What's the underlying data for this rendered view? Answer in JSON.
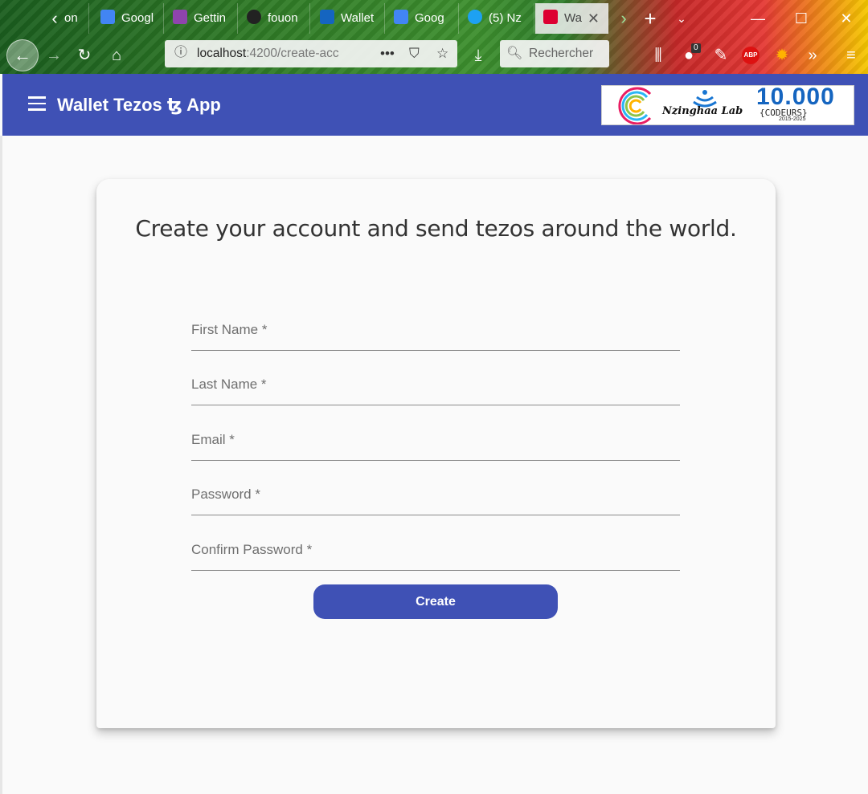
{
  "browser": {
    "tabs": [
      {
        "label": "on",
        "favicon_color": "#4b7c3a"
      },
      {
        "label": "Googl",
        "favicon_color": "#4285f4"
      },
      {
        "label": "Gettin",
        "favicon_color": "#8e44ad"
      },
      {
        "label": "fouon",
        "favicon_color": "#222222"
      },
      {
        "label": "Wallet",
        "favicon_color": "#1565c0"
      },
      {
        "label": "Goog",
        "favicon_color": "#4285f4"
      },
      {
        "label": "(5) Nz",
        "favicon_color": "#1da1f2"
      },
      {
        "label": "Wa",
        "favicon_color": "#dd0031",
        "active": true
      }
    ],
    "url_host": "localhost",
    "url_path": ":4200/create-acc",
    "search_placeholder": "Rechercher",
    "notification_count": "0",
    "adblock_label": "ABP"
  },
  "app": {
    "title": "Wallet Tezos ꜩ App",
    "partner_logo": {
      "name": "Nzinghaa Lab",
      "count": "10.000",
      "subtitle": "{CODEURS}",
      "years": "2015-2025"
    }
  },
  "form": {
    "headline": "Create your account and send tezos around the world.",
    "fields": [
      {
        "placeholder": "First Name *",
        "value": ""
      },
      {
        "placeholder": "Last Name *",
        "value": ""
      },
      {
        "placeholder": "Email *",
        "value": ""
      },
      {
        "placeholder": "Password *",
        "value": ""
      },
      {
        "placeholder": "Confirm Password *",
        "value": ""
      }
    ],
    "submit_label": "Create"
  },
  "colors": {
    "primary": "#3f51b5",
    "background": "#fafafa"
  }
}
